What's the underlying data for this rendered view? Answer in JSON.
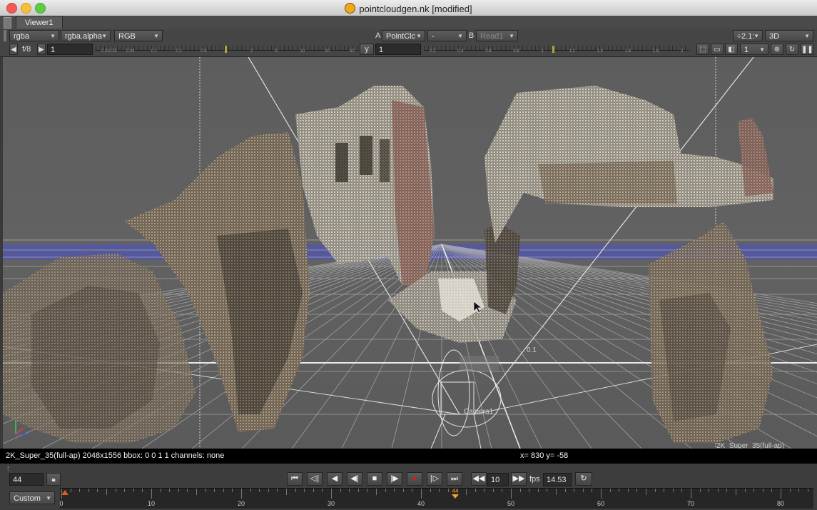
{
  "window": {
    "title": "pointcloudgen.nk [modified]"
  },
  "tabs": [
    {
      "label": "Viewer1"
    }
  ],
  "toolbar": {
    "channels": "rgba",
    "alpha_channel": "rgba.alpha",
    "display": "RGB",
    "a_label": "A",
    "a_input": "PointClc",
    "compare_mode": "-",
    "b_label": "B",
    "b_input": "Read1",
    "zoom": "÷2.1:",
    "view_mode": "3D",
    "fstop": "f/8",
    "gain_value": "1",
    "gamma_label": "y",
    "gamma_value": "1",
    "proxy_value": "1",
    "gain_ticks": [
      "0.03125",
      "0.04",
      "0.1",
      "0.2",
      "0.5",
      "1",
      "2",
      "5",
      "10",
      "20",
      "50"
    ],
    "gamma_ticks": [
      "0.2",
      "0.4",
      "0.6",
      "0.8",
      "1",
      "1.2",
      "1.4",
      "1.6",
      "1.8",
      "2"
    ]
  },
  "viewport": {
    "format_label": "2K_Super_35(full-ap)",
    "camera_label": "Camera1",
    "grid_label": "0.1",
    "colors": {
      "background": "#5f5f5f",
      "grid": "#b8b8b8",
      "horizon": "#4a50c8"
    }
  },
  "status": {
    "info": "2K_Super_35(full-ap) 2048x1556  bbox: 0 0 1 1 channels: none",
    "coords": "x=  830 y=  -58"
  },
  "playback": {
    "current_frame": "44",
    "increment": "10",
    "fps_label": "fps",
    "fps_value": "14.53",
    "range_mode": "Custom",
    "marker_frame": "44",
    "ruler_labels": [
      "0",
      "10",
      "20",
      "30",
      "40",
      "50",
      "60",
      "70",
      "80"
    ]
  }
}
